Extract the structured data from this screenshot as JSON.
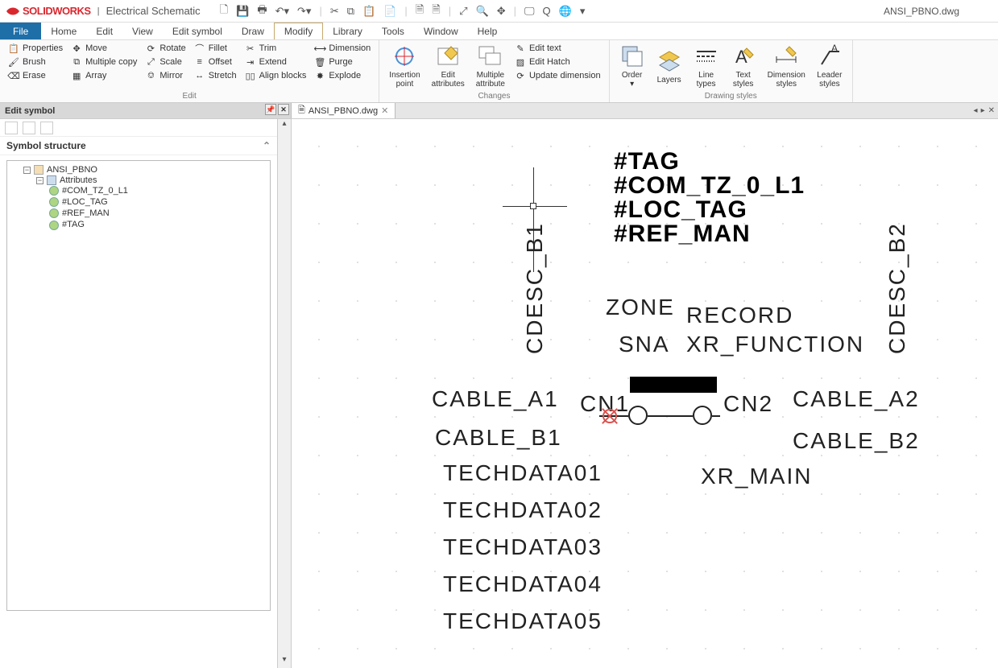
{
  "app": {
    "brand_ds": "DS",
    "brand_sw": "SOLIDWORKS",
    "brand_sep": "|",
    "brand_sub": "Electrical Schematic",
    "docname": "ANSI_PBNO.dwg"
  },
  "menu": {
    "file": "File",
    "home": "Home",
    "edit": "Edit",
    "view": "View",
    "editsymbol": "Edit symbol",
    "draw": "Draw",
    "modify": "Modify",
    "library": "Library",
    "tools": "Tools",
    "window": "Window",
    "help": "Help"
  },
  "ribbon": {
    "edit_group": "Edit",
    "changes_group": "Changes",
    "drawing_group": "Drawing styles",
    "cmds": {
      "properties": "Properties",
      "move": "Move",
      "rotate": "Rotate",
      "fillet": "Fillet",
      "trim": "Trim",
      "brush": "Brush",
      "multiplecopy": "Multiple copy",
      "scale": "Scale",
      "offset": "Offset",
      "extend": "Extend",
      "erase": "Erase",
      "array": "Array",
      "mirror": "Mirror",
      "stretch": "Stretch",
      "alignblocks": "Align blocks",
      "dimension": "Dimension",
      "purge": "Purge",
      "explode": "Explode",
      "insertionpoint": "Insertion\npoint",
      "editattributes": "Edit\nattributes",
      "multipleattribute": "Multiple\nattribute",
      "edittext": "Edit text",
      "edithatch": "Edit Hatch",
      "updatedimension": "Update dimension",
      "order": "Order",
      "layers": "Layers",
      "linetypes": "Line\ntypes",
      "textstyles": "Text\nstyles",
      "dimensionstyles": "Dimension\nstyles",
      "leaderstyles": "Leader\nstyles"
    }
  },
  "leftpanel": {
    "title": "Edit symbol",
    "section_title": "Symbol structure",
    "tree": {
      "root": "ANSI_PBNO",
      "attributes_label": "Attributes",
      "attrs": [
        "#COM_TZ_0_L1",
        "#LOC_TAG",
        "#REF_MAN",
        "#TAG"
      ]
    }
  },
  "doctab": {
    "name": "ANSI_PBNO.dwg"
  },
  "canvas": {
    "tag": "#TAG",
    "com": "#COM_TZ_0_L1",
    "loc": "#LOC_TAG",
    "ref": "#REF_MAN",
    "cdesc_b1": "CDESC_B1",
    "cdesc_b2": "CDESC_B2",
    "zone": "ZONE",
    "record": "RECORD",
    "sna": "SNA",
    "xr_function": "XR_FUNCTION",
    "cable_a1": "CABLE_A1",
    "cn1": "CN1",
    "cn2": "CN2",
    "cable_a2": "CABLE_A2",
    "cable_b1": "CABLE_B1",
    "cable_b2": "CABLE_B2",
    "techdata01": "TECHDATA01",
    "techdata02": "TECHDATA02",
    "techdata03": "TECHDATA03",
    "techdata04": "TECHDATA04",
    "techdata05": "TECHDATA05",
    "xr_main": "XR_MAIN"
  }
}
